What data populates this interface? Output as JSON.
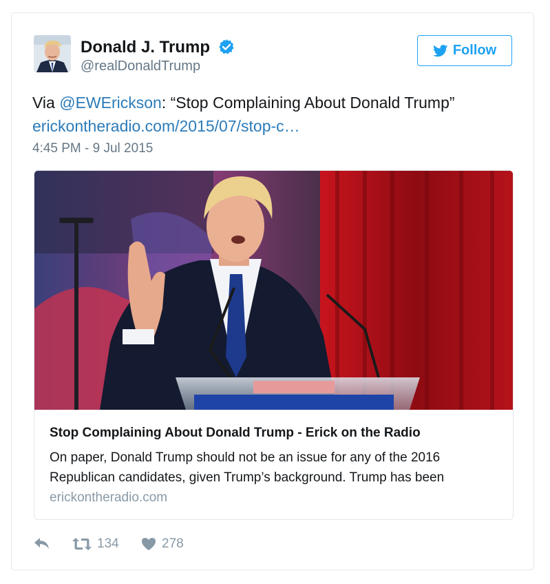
{
  "author": {
    "display_name": "Donald J. Trump",
    "handle": "@realDonaldTrump",
    "verified": true,
    "avatar_icon": "profile-photo"
  },
  "follow_button": {
    "label": "Follow",
    "icon": "twitter-bird-icon"
  },
  "tweet": {
    "prefix": "Via ",
    "mention": "@EWErickson",
    "quote": ": “Stop Complaining About Donald Trump”",
    "link": "erickontheradio.com/2015/07/stop-c…",
    "timestamp": "4:45 PM - 9 Jul 2015"
  },
  "card": {
    "title": "Stop Complaining About Donald Trump - Erick on the Radio",
    "description": "On paper, Donald Trump should not be an issue for any of the 2016 Republican candidates, given Trump’s background. Trump has been",
    "domain": "erickontheradio.com"
  },
  "actions": {
    "reply_icon": "reply-icon",
    "retweet_icon": "retweet-icon",
    "retweet_count": "134",
    "like_icon": "heart-icon",
    "like_count": "278"
  },
  "colors": {
    "brand_blue": "#1da1f2",
    "link_blue": "#2b7bb9",
    "muted_gray": "#657786",
    "border": "#e1e8ed"
  }
}
